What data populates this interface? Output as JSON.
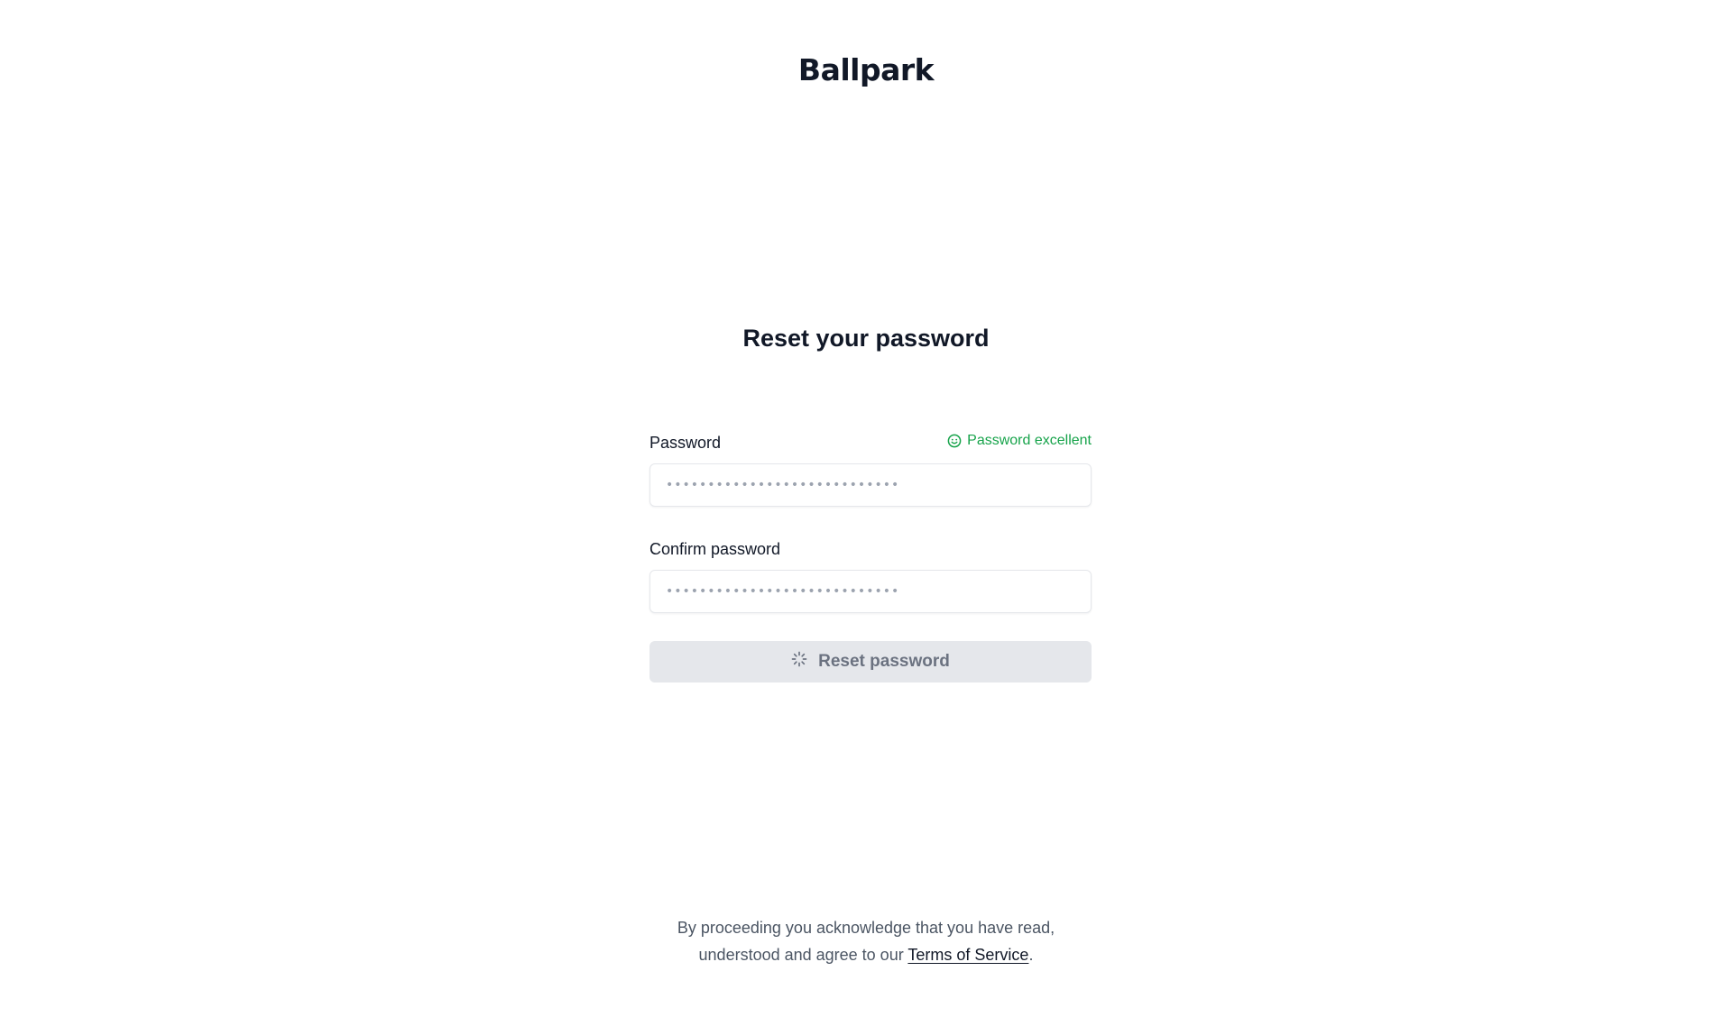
{
  "brand": {
    "logo_text": "Ballpark"
  },
  "heading": "Reset your password",
  "password": {
    "label": "Password",
    "value": "••••••••••••••••••••••••••••",
    "strength_text": "Password excellent",
    "strength_color": "#16a34a",
    "strength_icon": "smile-icon"
  },
  "confirm_password": {
    "label": "Confirm password",
    "value": "••••••••••••••••••••••••••••"
  },
  "submit": {
    "label": "Reset password",
    "state": "loading",
    "icon": "spinner-icon"
  },
  "footer": {
    "line1": "By proceeding you acknowledge that you have read,",
    "line2_prefix": "understood and agree to our ",
    "terms_link": "Terms of Service",
    "line2_suffix": "."
  }
}
